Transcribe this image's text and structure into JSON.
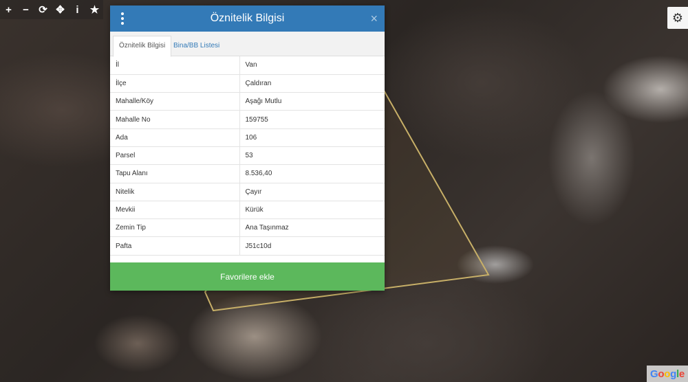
{
  "toolbar": {
    "tools": [
      {
        "icon": "zoom-in-icon",
        "glyph": "+"
      },
      {
        "icon": "zoom-out-icon",
        "glyph": "−"
      },
      {
        "icon": "refresh-icon",
        "glyph": "⟳"
      },
      {
        "icon": "locate-icon",
        "glyph": "✥"
      },
      {
        "icon": "info-icon",
        "glyph": "i"
      },
      {
        "icon": "favorite-star-icon",
        "glyph": "★"
      }
    ]
  },
  "settings": {
    "icon": "gear-icon",
    "glyph": "⚙"
  },
  "map": {
    "attribution": "Google",
    "parcel_color": "#c8b068"
  },
  "panel": {
    "title": "Öznitelik Bilgisi",
    "close_glyph": "×",
    "header_color": "#337ab7",
    "tabs": [
      {
        "label": "Öznitelik Bilgisi",
        "active": true
      },
      {
        "label": "Bina/BB Listesi",
        "active": false
      }
    ],
    "rows": [
      {
        "key": "İl",
        "value": "Van"
      },
      {
        "key": "İlçe",
        "value": "Çaldıran"
      },
      {
        "key": "Mahalle/Köy",
        "value": "Aşağı Mutlu"
      },
      {
        "key": "Mahalle No",
        "value": "159755"
      },
      {
        "key": "Ada",
        "value": "106"
      },
      {
        "key": "Parsel",
        "value": "53"
      },
      {
        "key": "Tapu Alanı",
        "value": "8.536,40"
      },
      {
        "key": "Nitelik",
        "value": "Çayır"
      },
      {
        "key": "Mevkii",
        "value": "Kürük"
      },
      {
        "key": "Zemin Tip",
        "value": "Ana Taşınmaz"
      },
      {
        "key": "Pafta",
        "value": "J51c10d"
      }
    ],
    "favorite_label": "Favorilere ekle",
    "favorite_color": "#5cb85c"
  }
}
